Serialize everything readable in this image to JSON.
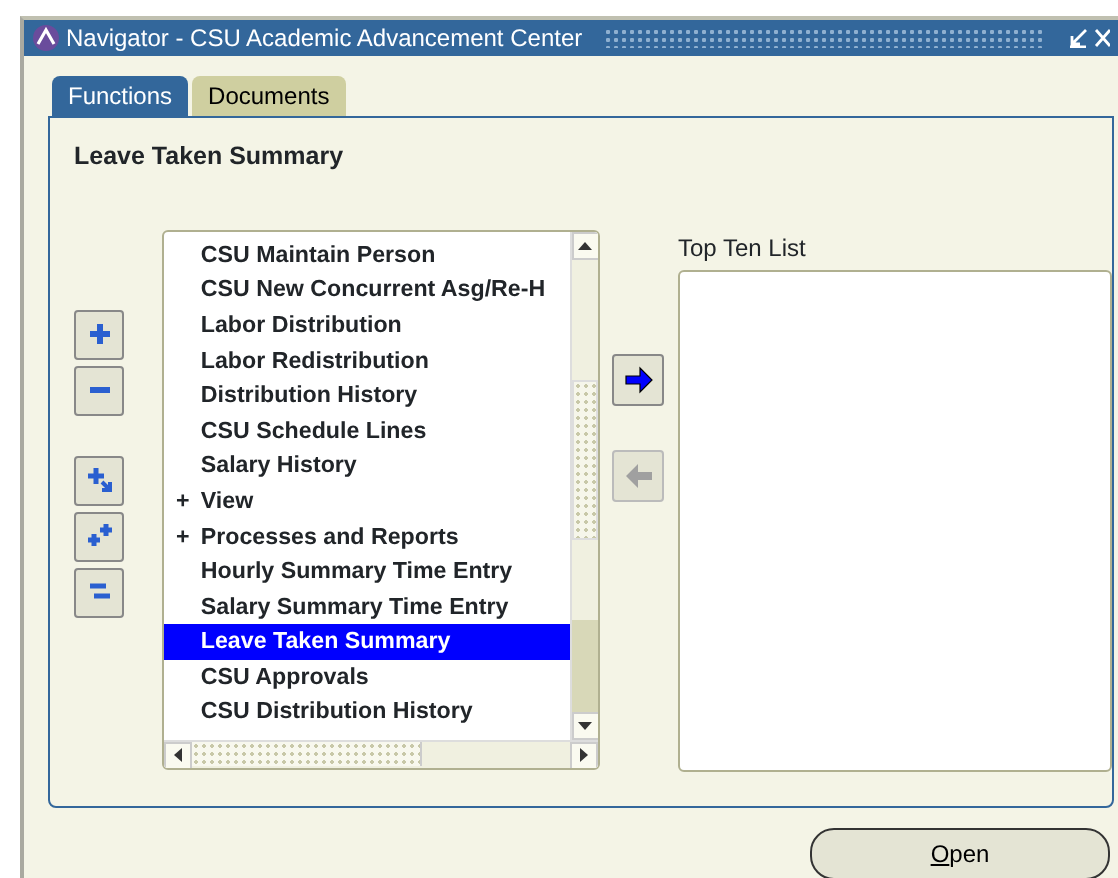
{
  "window": {
    "title": "Navigator - CSU Academic Advancement Center"
  },
  "tabs": [
    {
      "label": "Functions",
      "selected": true
    },
    {
      "label": "Documents",
      "selected": false
    }
  ],
  "heading": "Leave Taken Summary",
  "tool_buttons": [
    {
      "kind": "expand"
    },
    {
      "kind": "collapse"
    },
    {
      "kind": "expand-branch"
    },
    {
      "kind": "expand-all"
    },
    {
      "kind": "collapse-all"
    }
  ],
  "tree": [
    {
      "label": "CSU Maintain Person",
      "selected": false
    },
    {
      "label": "CSU New Concurrent Asg/Re-H",
      "selected": false
    },
    {
      "label": "Labor Distribution",
      "selected": false
    },
    {
      "label": "Labor Redistribution",
      "selected": false
    },
    {
      "label": "Distribution History",
      "selected": false
    },
    {
      "label": "CSU Schedule Lines",
      "selected": false
    },
    {
      "label": "Salary History",
      "selected": false
    },
    {
      "label": "View",
      "selected": false,
      "marker": "+"
    },
    {
      "label": "Processes and Reports",
      "selected": false,
      "marker": "+"
    },
    {
      "label": "Hourly Summary Time Entry",
      "selected": false
    },
    {
      "label": "Salary Summary Time Entry",
      "selected": false
    },
    {
      "label": "Leave Taken Summary",
      "selected": true
    },
    {
      "label": "CSU Approvals",
      "selected": false
    },
    {
      "label": "CSU Distribution History",
      "selected": false
    }
  ],
  "move_buttons": [
    {
      "kind": "add",
      "disabled": false
    },
    {
      "kind": "remove",
      "disabled": true
    }
  ],
  "top_ten": {
    "label": "Top Ten List"
  },
  "open_button": {
    "label": "Open",
    "underline_first": true
  }
}
